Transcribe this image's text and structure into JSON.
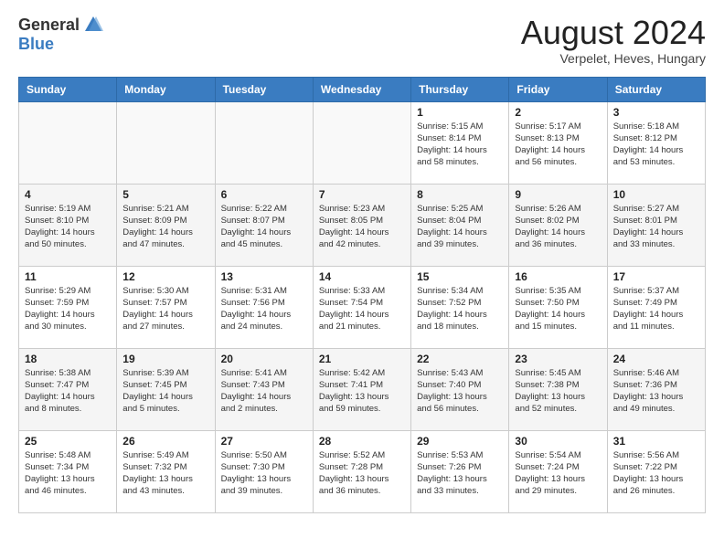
{
  "header": {
    "logo_general": "General",
    "logo_blue": "Blue",
    "month_title": "August 2024",
    "subtitle": "Verpelet, Heves, Hungary"
  },
  "weekdays": [
    "Sunday",
    "Monday",
    "Tuesday",
    "Wednesday",
    "Thursday",
    "Friday",
    "Saturday"
  ],
  "weeks": [
    [
      {
        "day": "",
        "info": ""
      },
      {
        "day": "",
        "info": ""
      },
      {
        "day": "",
        "info": ""
      },
      {
        "day": "",
        "info": ""
      },
      {
        "day": "1",
        "info": "Sunrise: 5:15 AM\nSunset: 8:14 PM\nDaylight: 14 hours\nand 58 minutes."
      },
      {
        "day": "2",
        "info": "Sunrise: 5:17 AM\nSunset: 8:13 PM\nDaylight: 14 hours\nand 56 minutes."
      },
      {
        "day": "3",
        "info": "Sunrise: 5:18 AM\nSunset: 8:12 PM\nDaylight: 14 hours\nand 53 minutes."
      }
    ],
    [
      {
        "day": "4",
        "info": "Sunrise: 5:19 AM\nSunset: 8:10 PM\nDaylight: 14 hours\nand 50 minutes."
      },
      {
        "day": "5",
        "info": "Sunrise: 5:21 AM\nSunset: 8:09 PM\nDaylight: 14 hours\nand 47 minutes."
      },
      {
        "day": "6",
        "info": "Sunrise: 5:22 AM\nSunset: 8:07 PM\nDaylight: 14 hours\nand 45 minutes."
      },
      {
        "day": "7",
        "info": "Sunrise: 5:23 AM\nSunset: 8:05 PM\nDaylight: 14 hours\nand 42 minutes."
      },
      {
        "day": "8",
        "info": "Sunrise: 5:25 AM\nSunset: 8:04 PM\nDaylight: 14 hours\nand 39 minutes."
      },
      {
        "day": "9",
        "info": "Sunrise: 5:26 AM\nSunset: 8:02 PM\nDaylight: 14 hours\nand 36 minutes."
      },
      {
        "day": "10",
        "info": "Sunrise: 5:27 AM\nSunset: 8:01 PM\nDaylight: 14 hours\nand 33 minutes."
      }
    ],
    [
      {
        "day": "11",
        "info": "Sunrise: 5:29 AM\nSunset: 7:59 PM\nDaylight: 14 hours\nand 30 minutes."
      },
      {
        "day": "12",
        "info": "Sunrise: 5:30 AM\nSunset: 7:57 PM\nDaylight: 14 hours\nand 27 minutes."
      },
      {
        "day": "13",
        "info": "Sunrise: 5:31 AM\nSunset: 7:56 PM\nDaylight: 14 hours\nand 24 minutes."
      },
      {
        "day": "14",
        "info": "Sunrise: 5:33 AM\nSunset: 7:54 PM\nDaylight: 14 hours\nand 21 minutes."
      },
      {
        "day": "15",
        "info": "Sunrise: 5:34 AM\nSunset: 7:52 PM\nDaylight: 14 hours\nand 18 minutes."
      },
      {
        "day": "16",
        "info": "Sunrise: 5:35 AM\nSunset: 7:50 PM\nDaylight: 14 hours\nand 15 minutes."
      },
      {
        "day": "17",
        "info": "Sunrise: 5:37 AM\nSunset: 7:49 PM\nDaylight: 14 hours\nand 11 minutes."
      }
    ],
    [
      {
        "day": "18",
        "info": "Sunrise: 5:38 AM\nSunset: 7:47 PM\nDaylight: 14 hours\nand 8 minutes."
      },
      {
        "day": "19",
        "info": "Sunrise: 5:39 AM\nSunset: 7:45 PM\nDaylight: 14 hours\nand 5 minutes."
      },
      {
        "day": "20",
        "info": "Sunrise: 5:41 AM\nSunset: 7:43 PM\nDaylight: 14 hours\nand 2 minutes."
      },
      {
        "day": "21",
        "info": "Sunrise: 5:42 AM\nSunset: 7:41 PM\nDaylight: 13 hours\nand 59 minutes."
      },
      {
        "day": "22",
        "info": "Sunrise: 5:43 AM\nSunset: 7:40 PM\nDaylight: 13 hours\nand 56 minutes."
      },
      {
        "day": "23",
        "info": "Sunrise: 5:45 AM\nSunset: 7:38 PM\nDaylight: 13 hours\nand 52 minutes."
      },
      {
        "day": "24",
        "info": "Sunrise: 5:46 AM\nSunset: 7:36 PM\nDaylight: 13 hours\nand 49 minutes."
      }
    ],
    [
      {
        "day": "25",
        "info": "Sunrise: 5:48 AM\nSunset: 7:34 PM\nDaylight: 13 hours\nand 46 minutes."
      },
      {
        "day": "26",
        "info": "Sunrise: 5:49 AM\nSunset: 7:32 PM\nDaylight: 13 hours\nand 43 minutes."
      },
      {
        "day": "27",
        "info": "Sunrise: 5:50 AM\nSunset: 7:30 PM\nDaylight: 13 hours\nand 39 minutes."
      },
      {
        "day": "28",
        "info": "Sunrise: 5:52 AM\nSunset: 7:28 PM\nDaylight: 13 hours\nand 36 minutes."
      },
      {
        "day": "29",
        "info": "Sunrise: 5:53 AM\nSunset: 7:26 PM\nDaylight: 13 hours\nand 33 minutes."
      },
      {
        "day": "30",
        "info": "Sunrise: 5:54 AM\nSunset: 7:24 PM\nDaylight: 13 hours\nand 29 minutes."
      },
      {
        "day": "31",
        "info": "Sunrise: 5:56 AM\nSunset: 7:22 PM\nDaylight: 13 hours\nand 26 minutes."
      }
    ]
  ]
}
